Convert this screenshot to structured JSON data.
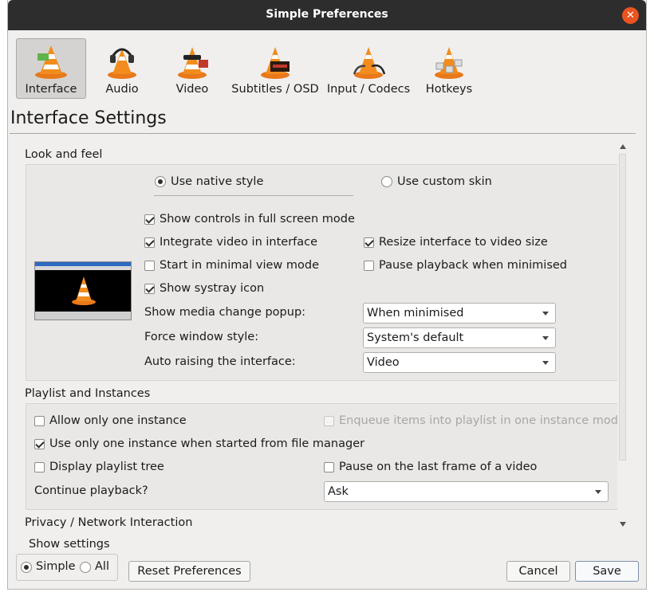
{
  "window": {
    "title": "Simple Preferences"
  },
  "categories": [
    {
      "label": "Interface",
      "selected": true,
      "icon": "interface-cone-icon"
    },
    {
      "label": "Audio",
      "selected": false,
      "icon": "audio-cone-icon"
    },
    {
      "label": "Video",
      "selected": false,
      "icon": "video-cone-icon"
    },
    {
      "label": "Subtitles / OSD",
      "selected": false,
      "icon": "subtitles-cone-icon"
    },
    {
      "label": "Input / Codecs",
      "selected": false,
      "icon": "input-cone-icon"
    },
    {
      "label": "Hotkeys",
      "selected": false,
      "icon": "hotkeys-cone-icon"
    }
  ],
  "panel": {
    "title": "Interface Settings"
  },
  "look_and_feel": {
    "title": "Look and feel",
    "native_style": "Use native style",
    "custom_skin": "Use custom skin",
    "fullscreen_controls": "Show controls in full screen mode",
    "integrate_video": "Integrate video in interface",
    "resize_interface": "Resize interface to video size",
    "minimal_view": "Start in minimal view mode",
    "pause_minimised": "Pause playback when minimised",
    "systray": "Show systray icon",
    "media_popup_label": "Show media change popup:",
    "media_popup_value": "When minimised",
    "window_style_label": "Force window style:",
    "window_style_value": "System's default",
    "auto_raise_label": "Auto raising the interface:",
    "auto_raise_value": "Video"
  },
  "playlist": {
    "title": "Playlist and Instances",
    "one_instance": "Allow only one instance",
    "enqueue": "Enqueue items into playlist in one instance mode",
    "file_manager": "Use only one instance when started from file manager",
    "playlist_tree": "Display playlist tree",
    "pause_last_frame": "Pause on the last frame of a video",
    "continue_label": "Continue playback?",
    "continue_value": "Ask"
  },
  "privacy": {
    "title": "Privacy / Network Interaction"
  },
  "footer": {
    "show_settings": "Show settings",
    "simple": "Simple",
    "all": "All",
    "reset": "Reset Preferences",
    "cancel": "Cancel",
    "save": "Save"
  },
  "colors": {
    "titlebar": "#2d2d2d",
    "close": "#e95420",
    "window": "#f0efee",
    "cone_orange": "#f28c1e"
  }
}
